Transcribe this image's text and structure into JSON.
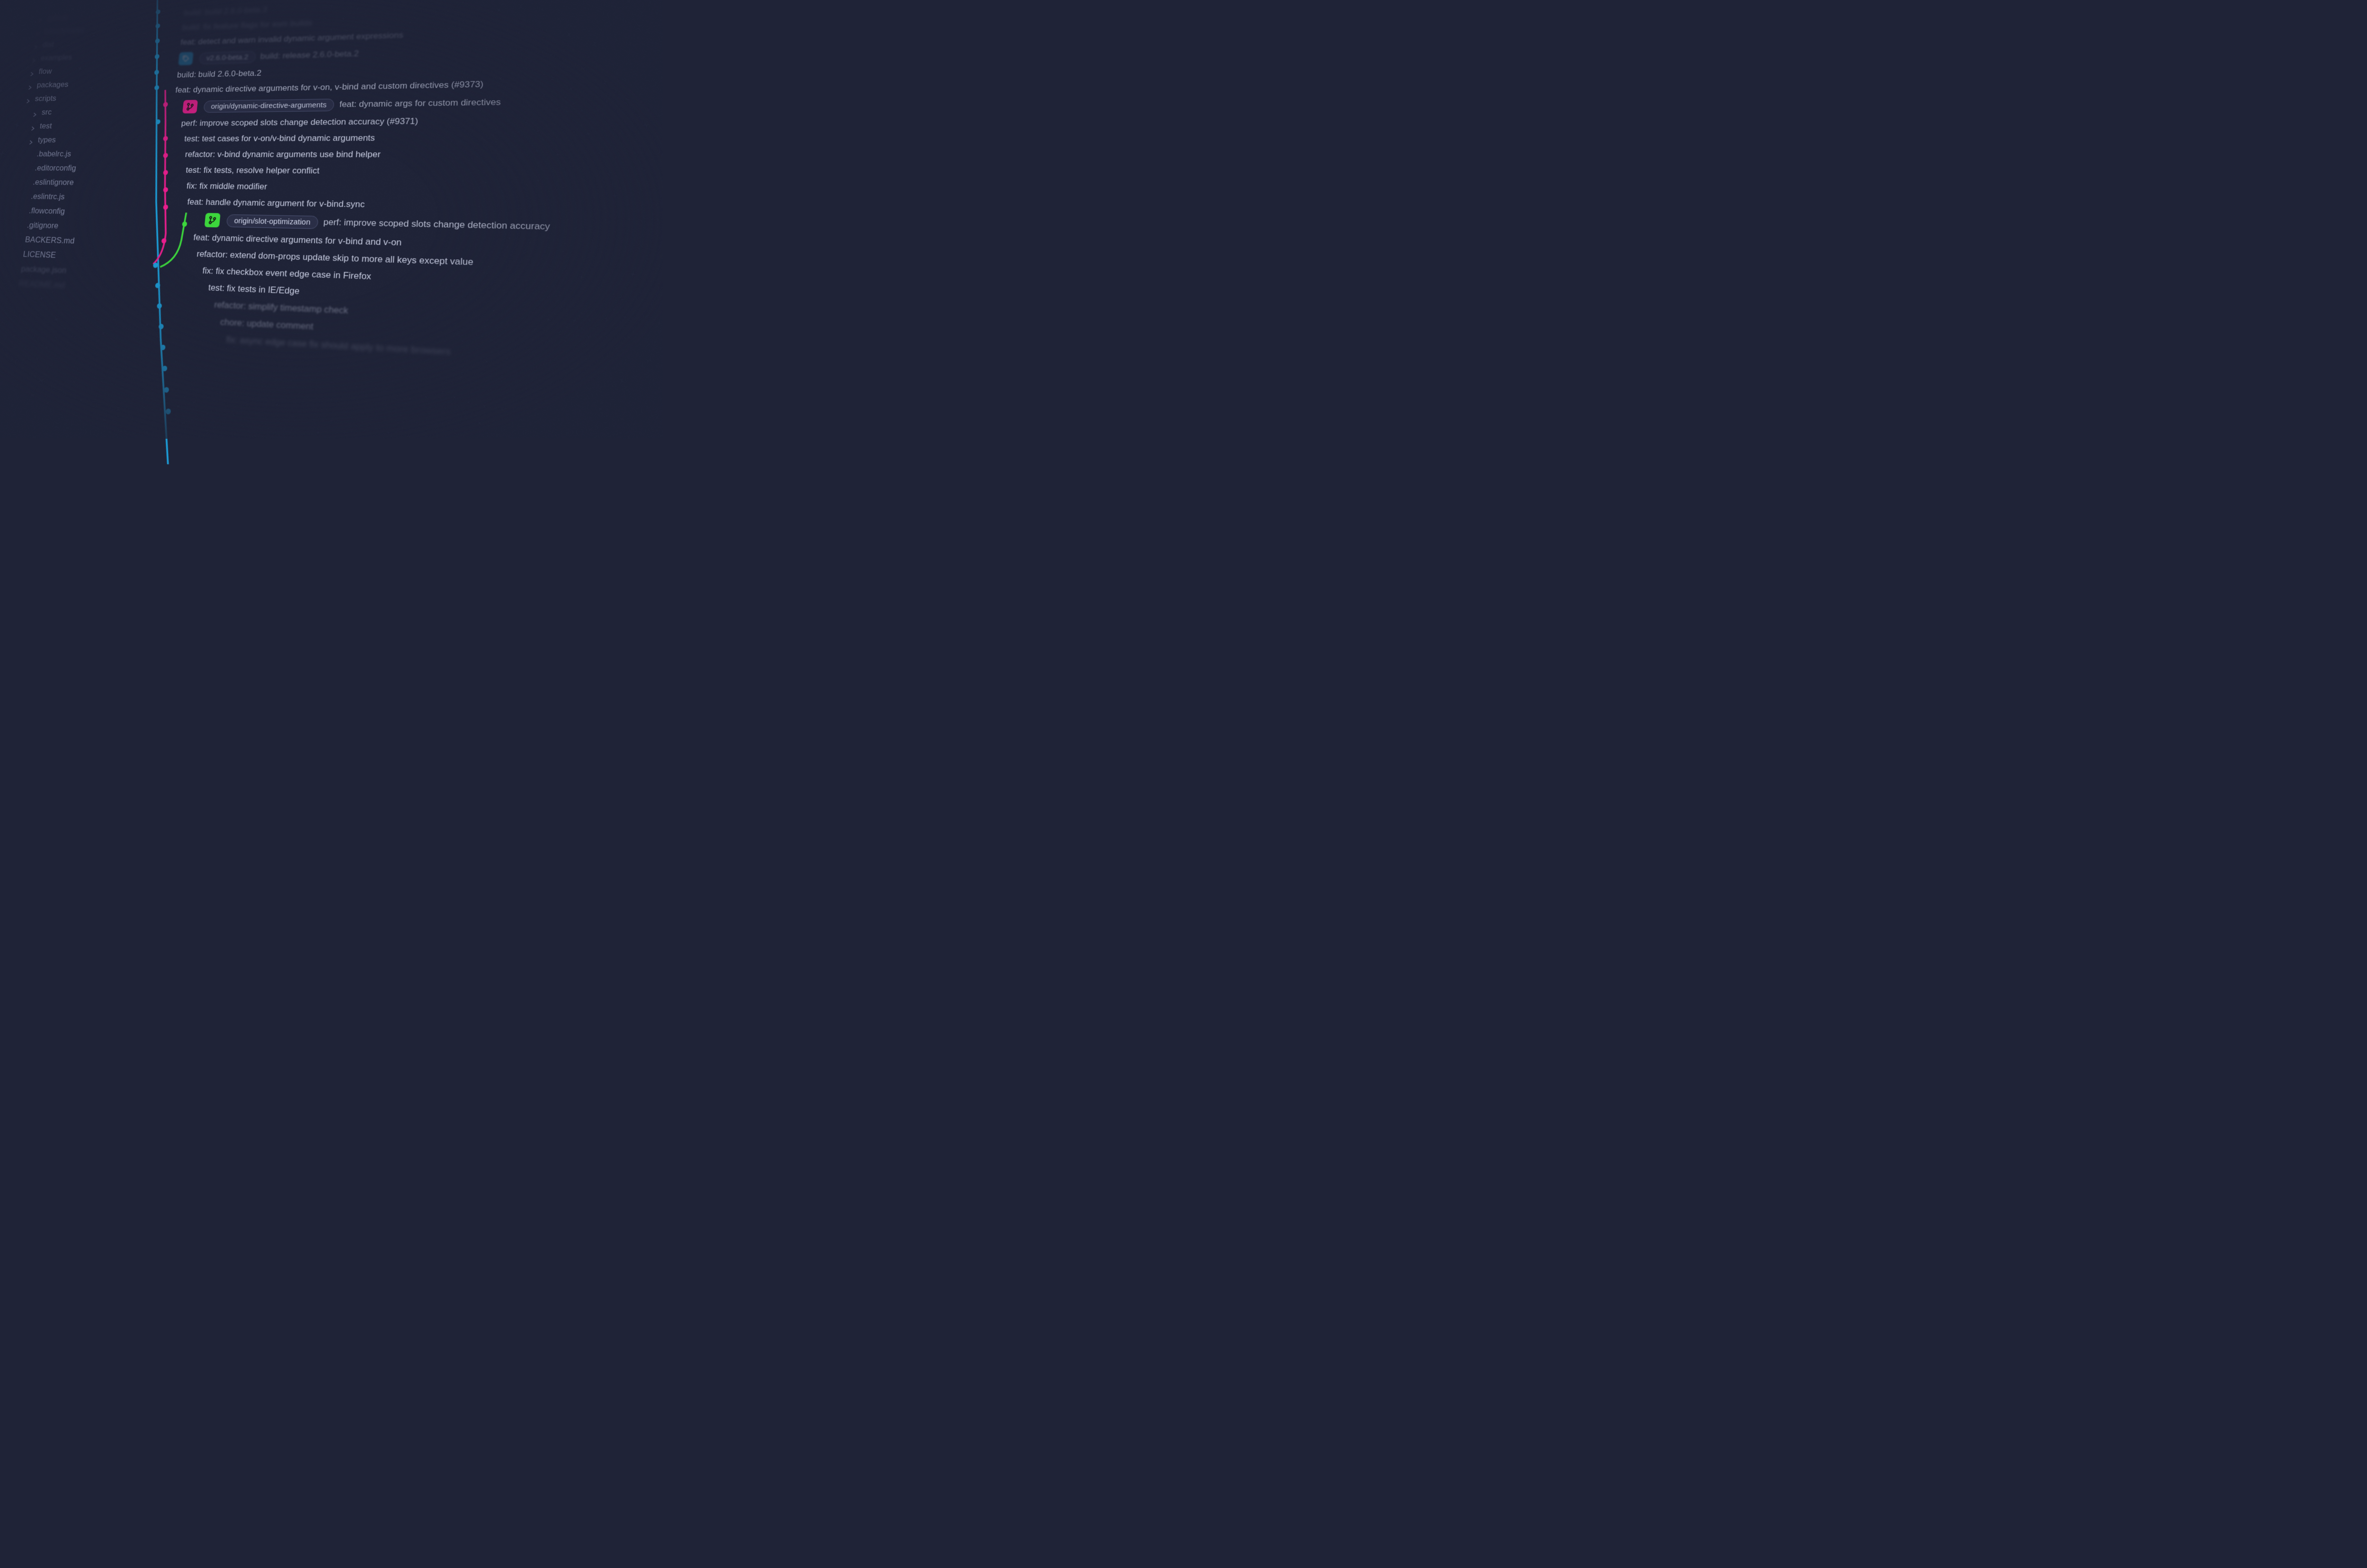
{
  "colors": {
    "main_branch": "#1c9dd8",
    "branch2": "#e91e8c",
    "branch3": "#3cd63c",
    "background": "#1f2337",
    "text": "#b8bdd1"
  },
  "sidebar": {
    "items": [
      {
        "label": ".github",
        "type": "folder",
        "indent": 0,
        "fade": "very-faded"
      },
      {
        "label": "benchmarks",
        "type": "folder",
        "indent": 0,
        "fade": "very-faded"
      },
      {
        "label": "dist",
        "type": "folder",
        "indent": 0,
        "fade": "faded"
      },
      {
        "label": "examples",
        "type": "folder",
        "indent": 0,
        "fade": "faded"
      },
      {
        "label": "flow",
        "type": "folder",
        "indent": 0,
        "fade": ""
      },
      {
        "label": "packages",
        "type": "folder",
        "indent": 0,
        "fade": ""
      },
      {
        "label": "scripts",
        "type": "folder",
        "indent": 0,
        "fade": ""
      },
      {
        "label": "src",
        "type": "folder",
        "indent": 1,
        "fade": ""
      },
      {
        "label": "test",
        "type": "folder",
        "indent": 1,
        "fade": ""
      },
      {
        "label": "types",
        "type": "folder",
        "indent": 1,
        "fade": ""
      },
      {
        "label": ".babelrc.js",
        "type": "file",
        "indent": 2,
        "fade": ""
      },
      {
        "label": ".editorconfig",
        "type": "file",
        "indent": 2,
        "fade": ""
      },
      {
        "label": ".eslintignore",
        "type": "file",
        "indent": 2,
        "fade": ""
      },
      {
        "label": ".eslintrc.js",
        "type": "file",
        "indent": 2,
        "fade": ""
      },
      {
        "label": ".flowconfig",
        "type": "file",
        "indent": 2,
        "fade": ""
      },
      {
        "label": ".gitignore",
        "type": "file",
        "indent": 2,
        "fade": ""
      },
      {
        "label": "BACKERS.md",
        "type": "file",
        "indent": 2,
        "fade": ""
      },
      {
        "label": "LICENSE",
        "type": "file",
        "indent": 2,
        "fade": ""
      },
      {
        "label": "package.json",
        "type": "file",
        "indent": 2,
        "fade": "faded"
      },
      {
        "label": "README.md",
        "type": "file",
        "indent": 2,
        "fade": "very-faded"
      }
    ]
  },
  "commits": [
    {
      "msg": "build: build 2.6.0-beta.3",
      "fade": "very-faded",
      "tag": null,
      "indent": 0
    },
    {
      "msg": "build: fix feature flags for esm builds",
      "fade": "very-faded",
      "tag": null,
      "indent": 0
    },
    {
      "msg": "feat: detect and warn invalid dynamic argument expressions",
      "fade": "faded",
      "tag": null,
      "indent": 0
    },
    {
      "msg": "build: release 2.6.0-beta.2",
      "fade": "faded",
      "tag": {
        "color": "blue",
        "label": "v2.6.0-beta.2",
        "icon": "tag"
      },
      "indent": 0
    },
    {
      "msg": "build: build 2.6.0-beta.2",
      "fade": "",
      "tag": null,
      "indent": 0
    },
    {
      "msg": "feat: dynamic directive arguments for v-on, v-bind and custom directives (#9373)",
      "fade": "",
      "tag": null,
      "indent": 0
    },
    {
      "msg": "feat: dynamic args for custom directives",
      "fade": "",
      "tag": {
        "color": "pink",
        "label": "origin/dynamic-directive-arguments",
        "icon": "branch"
      },
      "indent": 20
    },
    {
      "msg": "perf: improve scoped slots change detection accuracy (#9371)",
      "fade": "",
      "tag": null,
      "indent": 20
    },
    {
      "msg": "test: test cases for v-on/v-bind dynamic arguments",
      "fade": "",
      "tag": null,
      "indent": 30
    },
    {
      "msg": "refactor: v-bind dynamic arguments use bind helper",
      "fade": "",
      "tag": null,
      "indent": 35
    },
    {
      "msg": "test: fix tests, resolve helper conflict",
      "fade": "",
      "tag": null,
      "indent": 40
    },
    {
      "msg": "fix: fix middle modifier",
      "fade": "",
      "tag": null,
      "indent": 45
    },
    {
      "msg": "feat: handle dynamic argument for v-bind.sync",
      "fade": "",
      "tag": null,
      "indent": 50
    },
    {
      "msg": "perf: improve scoped slots change detection accuracy",
      "fade": "",
      "tag": {
        "color": "green",
        "label": "origin/slot-optimization",
        "icon": "branch"
      },
      "indent": 90
    },
    {
      "msg": "feat: dynamic directive arguments for v-bind and v-on",
      "fade": "",
      "tag": null,
      "indent": 70
    },
    {
      "msg": "refactor: extend dom-props update skip to more all keys except value",
      "fade": "",
      "tag": null,
      "indent": 80
    },
    {
      "msg": "fix: fix checkbox event edge case in Firefox",
      "fade": "",
      "tag": null,
      "indent": 95
    },
    {
      "msg": "test: fix tests in IE/Edge",
      "fade": "",
      "tag": null,
      "indent": 110
    },
    {
      "msg": "refactor: simplify timestamp check",
      "fade": "faded",
      "tag": null,
      "indent": 125
    },
    {
      "msg": "chore: update comment",
      "fade": "faded",
      "tag": null,
      "indent": 140
    },
    {
      "msg": "fix: async edge case fix should apply to more browsers",
      "fade": "very-faded",
      "tag": null,
      "indent": 155
    }
  ]
}
